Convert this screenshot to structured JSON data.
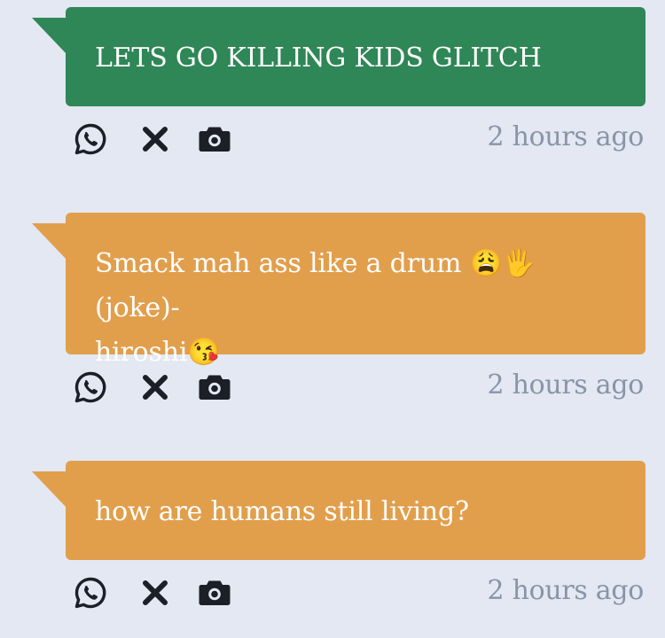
{
  "colors": {
    "background": "#e3e8f2",
    "green": "#2f8656",
    "orange": "#e19f4c",
    "timestamp": "#8a94a8",
    "icon": "#1c1f27"
  },
  "posts": [
    {
      "color": "#2f8656",
      "text_lines": [
        "LETS GO KILLING KIDS GLITCH"
      ],
      "timestamp": "2 hours ago",
      "icons": [
        "whatsapp-icon",
        "close-icon",
        "camera-icon"
      ]
    },
    {
      "color": "#e19f4c",
      "text_lines": [
        "Smack mah ass like a drum 😩🖐 (joke)-",
        "hiroshi😘"
      ],
      "timestamp": "2 hours ago",
      "icons": [
        "whatsapp-icon",
        "close-icon",
        "camera-icon"
      ]
    },
    {
      "color": "#e19f4c",
      "text_lines": [
        "how are humans still living?"
      ],
      "timestamp": "2 hours ago",
      "icons": [
        "whatsapp-icon",
        "close-icon",
        "camera-icon"
      ]
    }
  ]
}
